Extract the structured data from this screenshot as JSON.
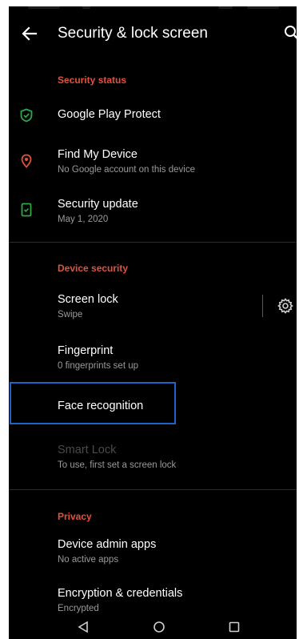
{
  "appbar": {
    "title": "Security & lock screen"
  },
  "sections": {
    "security_status": "Security status",
    "device_security": "Device security",
    "privacy": "Privacy"
  },
  "items": {
    "play_protect": {
      "title": "Google Play Protect"
    },
    "find_device": {
      "title": "Find My Device",
      "subtitle": "No Google account on this device"
    },
    "security_update": {
      "title": "Security update",
      "subtitle": "May 1, 2020"
    },
    "screen_lock": {
      "title": "Screen lock",
      "subtitle": "Swipe"
    },
    "fingerprint": {
      "title": "Fingerprint",
      "subtitle": "0 fingerprints set up"
    },
    "face_recognition": {
      "title": "Face recognition"
    },
    "smart_lock": {
      "title": "Smart Lock",
      "subtitle": "To use, first set a screen lock"
    },
    "device_admin": {
      "title": "Device admin apps",
      "subtitle": "No active apps"
    },
    "encryption": {
      "title": "Encryption & credentials",
      "subtitle": "Encrypted"
    }
  },
  "colors": {
    "accent": "#e0523c",
    "shield_green": "#2ea84a",
    "location_red": "#e0523c",
    "focus_blue": "#1e64c8"
  },
  "icons": {
    "back": "arrow-back-icon",
    "search": "search-icon",
    "play_protect": "shield-check-icon",
    "find_device": "location-pin-icon",
    "security_update": "phone-update-icon",
    "screen_lock_settings": "gear-icon",
    "nav_back": "triangle-back-icon",
    "nav_home": "circle-home-icon",
    "nav_recents": "square-recents-icon"
  }
}
